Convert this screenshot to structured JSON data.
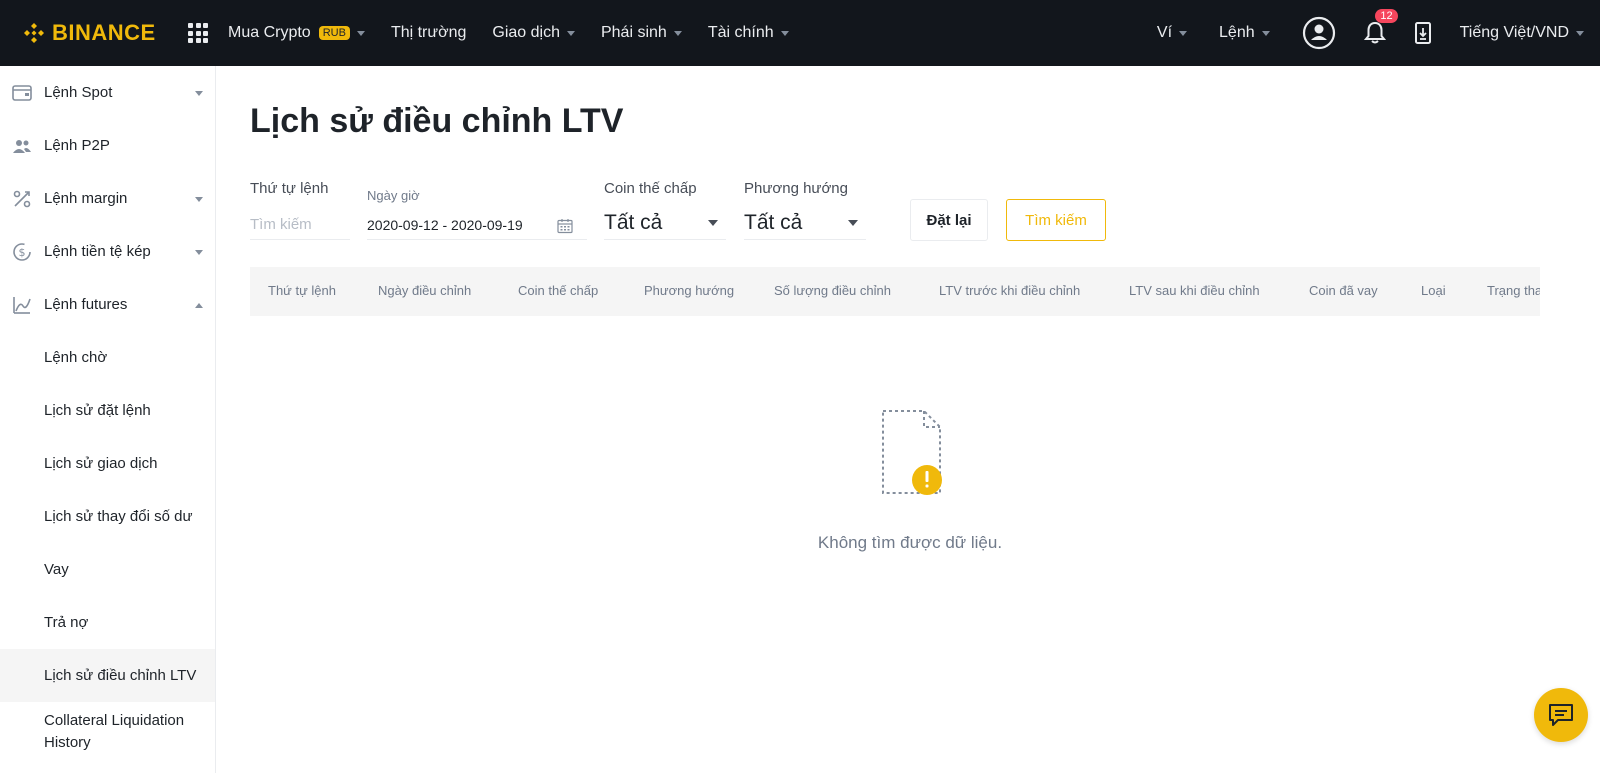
{
  "brand": {
    "name": "BINANCE",
    "color": "#f0b90b"
  },
  "topnav": {
    "items": [
      {
        "label": "Mua Crypto",
        "badge": "RUB",
        "dropdown": true
      },
      {
        "label": "Thị trường",
        "dropdown": false
      },
      {
        "label": "Giao dịch",
        "dropdown": true
      },
      {
        "label": "Phái sinh",
        "dropdown": true
      },
      {
        "label": "Tài chính",
        "dropdown": true
      }
    ],
    "right": {
      "wallet": "Ví",
      "orders": "Lệnh",
      "notifications_count": "12",
      "language": "Tiếng Việt/VND"
    }
  },
  "sidebar": {
    "items": [
      {
        "label": "Lệnh Spot",
        "icon": "wallet-icon"
      },
      {
        "label": "Lệnh P2P",
        "icon": "users-icon"
      },
      {
        "label": "Lệnh margin",
        "icon": "percent-icon"
      },
      {
        "label": "Lệnh tiền tệ kép",
        "icon": "dollar-cycle-icon"
      },
      {
        "label": "Lệnh futures",
        "icon": "futures-chart-icon"
      },
      {
        "label": "Lệnh chờ"
      },
      {
        "label": "Lịch sử đặt lệnh"
      },
      {
        "label": "Lịch sử giao dịch"
      },
      {
        "label": "Lịch sử thay đổi số dư"
      },
      {
        "label": "Vay"
      },
      {
        "label": "Trả nợ"
      },
      {
        "label": "Lịch sử điều chỉnh LTV",
        "active": true
      },
      {
        "label": "Collateral Liquidation History"
      }
    ]
  },
  "main": {
    "title": "Lịch sử điều chỉnh LTV",
    "filters": {
      "order_no_label": "Thứ tự lệnh",
      "order_no_placeholder": "Tìm kiếm",
      "date_label": "Ngày giờ",
      "date_value": "2020-09-12 - 2020-09-19",
      "collateral_label": "Coin thế chấp",
      "collateral_value": "Tất cả",
      "direction_label": "Phương hướng",
      "direction_value": "Tất cả",
      "reset_label": "Đặt lại",
      "search_label": "Tìm kiếm"
    },
    "table": {
      "columns": [
        "Thứ tự lệnh",
        "Ngày điều chỉnh",
        "Coin thế chấp",
        "Phương hướng",
        "Số lượng điều chỉnh",
        "LTV trước khi điều chỉnh",
        "LTV sau khi điều chỉnh",
        "Coin đã vay",
        "Loại",
        "Trạng tha"
      ],
      "empty_message": "Không tìm được dữ liệu."
    }
  }
}
